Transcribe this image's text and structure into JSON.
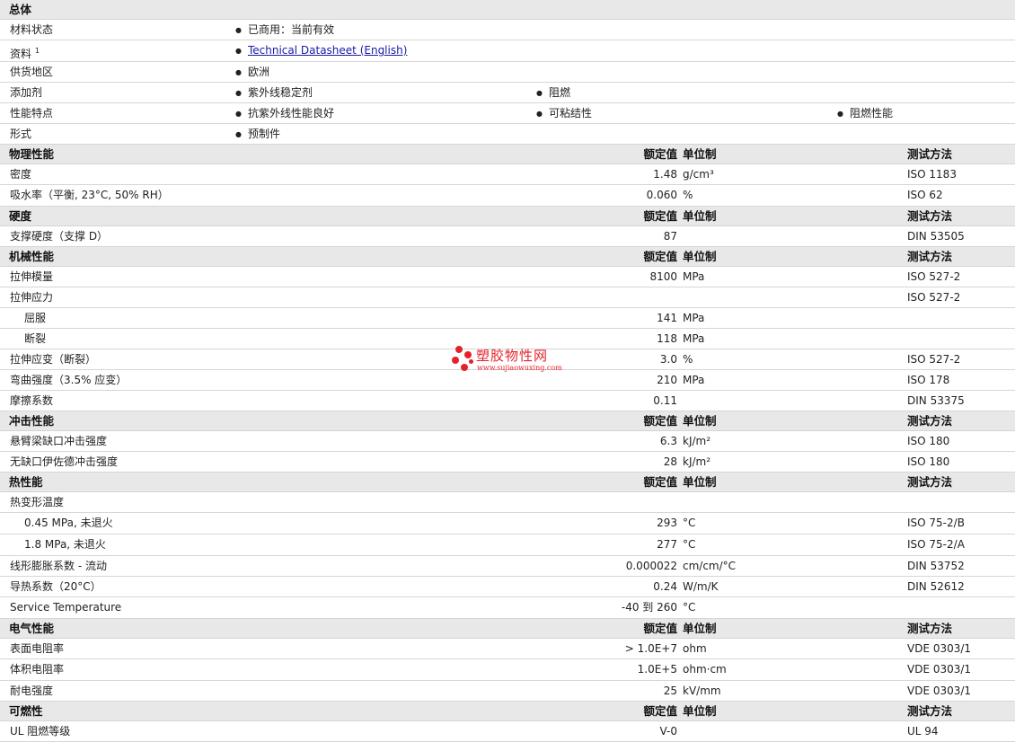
{
  "general": {
    "title": "总体",
    "rows": [
      {
        "label": "材料状态",
        "items": [
          "已商用：当前有效"
        ]
      },
      {
        "label": "资料",
        "sup": "1",
        "link": "Technical Datasheet (English)"
      },
      {
        "label": "供货地区",
        "items": [
          "欧洲"
        ]
      },
      {
        "label": "添加剂",
        "items": [
          "紫外线稳定剂",
          "阻燃"
        ]
      },
      {
        "label": "性能特点",
        "items": [
          "抗紫外线性能良好",
          "可粘结性",
          "阻燃性能"
        ]
      },
      {
        "label": "形式",
        "items": [
          "预制件"
        ]
      }
    ]
  },
  "column_headers": {
    "value": "额定值",
    "unit": "单位制",
    "method": "测试方法"
  },
  "sections": [
    {
      "title": "物理性能",
      "rows": [
        {
          "name": "密度",
          "value": "1.48",
          "unit": "g/cm³",
          "method": "ISO 1183"
        },
        {
          "name": "吸水率（平衡, 23°C, 50% RH）",
          "value": "0.060",
          "unit": "%",
          "method": "ISO 62"
        }
      ]
    },
    {
      "title": "硬度",
      "rows": [
        {
          "name": "支撑硬度（支撑 D）",
          "value": "87",
          "unit": "",
          "method": "DIN 53505"
        }
      ]
    },
    {
      "title": "机械性能",
      "rows": [
        {
          "name": "拉伸模量",
          "value": "8100",
          "unit": "MPa",
          "method": "ISO 527-2"
        },
        {
          "name": "拉伸应力",
          "value": "",
          "unit": "",
          "method": "ISO 527-2"
        },
        {
          "name": "屈服",
          "sub": true,
          "value": "141",
          "unit": "MPa",
          "method": ""
        },
        {
          "name": "断裂",
          "sub": true,
          "value": "118",
          "unit": "MPa",
          "method": ""
        },
        {
          "name": "拉伸应变（断裂）",
          "value": "3.0",
          "unit": "%",
          "method": "ISO 527-2"
        },
        {
          "name": "弯曲强度（3.5% 应变）",
          "value": "210",
          "unit": "MPa",
          "method": "ISO 178"
        },
        {
          "name": "摩擦系数",
          "value": "0.11",
          "unit": "",
          "method": "DIN 53375"
        }
      ]
    },
    {
      "title": "冲击性能",
      "rows": [
        {
          "name": "悬臂梁缺口冲击强度",
          "value": "6.3",
          "unit": "kJ/m²",
          "method": "ISO 180"
        },
        {
          "name": "无缺口伊佐德冲击强度",
          "value": "28",
          "unit": "kJ/m²",
          "method": "ISO 180"
        }
      ]
    },
    {
      "title": "热性能",
      "rows": [
        {
          "name": "热变形温度",
          "value": "",
          "unit": "",
          "method": ""
        },
        {
          "name": "0.45 MPa, 未退火",
          "sub": true,
          "value": "293",
          "unit": "°C",
          "method": "ISO 75-2/B"
        },
        {
          "name": "1.8 MPa, 未退火",
          "sub": true,
          "value": "277",
          "unit": "°C",
          "method": "ISO 75-2/A"
        },
        {
          "name": "线形膨胀系数 - 流动",
          "value": "0.000022",
          "unit": "cm/cm/°C",
          "method": "DIN 53752"
        },
        {
          "name": "导热系数（20°C）",
          "value": "0.24",
          "unit": "W/m/K",
          "method": "DIN 52612"
        },
        {
          "name": "Service Temperature",
          "value": "-40 到  260",
          "unit": "°C",
          "method": ""
        }
      ]
    },
    {
      "title": "电气性能",
      "rows": [
        {
          "name": "表面电阻率",
          "value": "> 1.0E+7",
          "unit": "ohm",
          "method": "VDE 0303/1"
        },
        {
          "name": "体积电阻率",
          "value": "1.0E+5",
          "unit": "ohm·cm",
          "method": "VDE 0303/1"
        },
        {
          "name": "耐电强度",
          "value": "25",
          "unit": "kV/mm",
          "method": "VDE 0303/1"
        }
      ]
    },
    {
      "title": "可燃性",
      "rows": [
        {
          "name": "UL 阻燃等级",
          "value": "V-0",
          "unit": "",
          "method": "UL 94"
        }
      ]
    }
  ],
  "watermark": {
    "name": "塑胶物性网",
    "url": "www.sujiaowuxing.com",
    "color": "#e5222a"
  }
}
